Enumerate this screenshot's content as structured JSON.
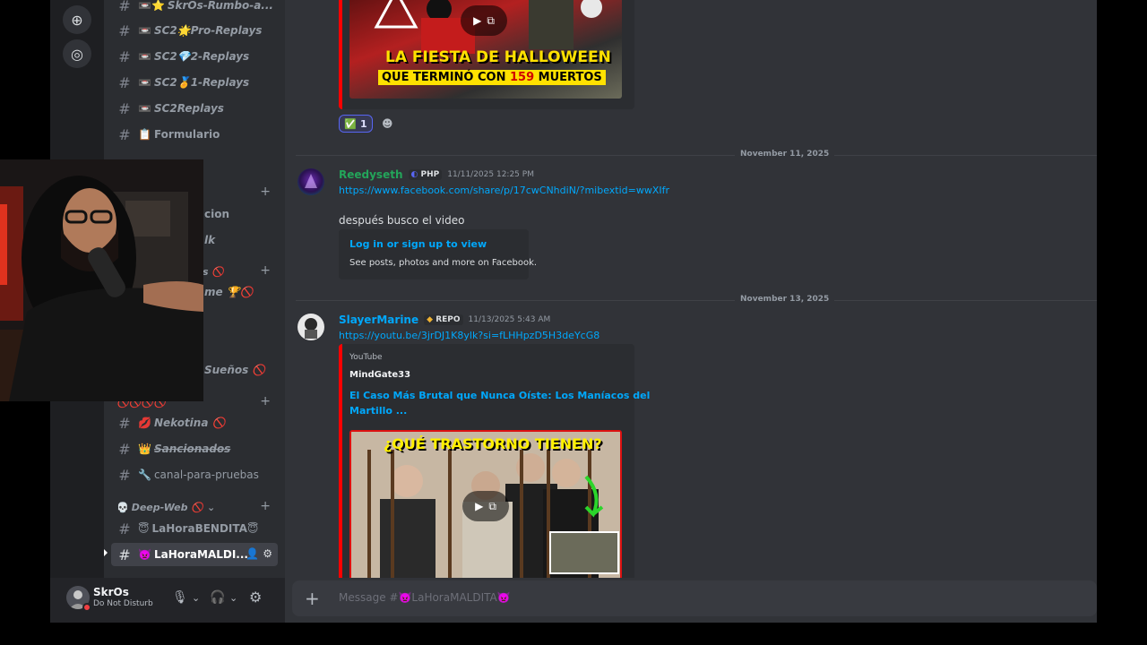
{
  "rail": {
    "add_icon": "plus-icon",
    "discover_icon": "compass-icon"
  },
  "sidebar": {
    "channels_top": [
      {
        "emoji": "📼⭐",
        "label": "SkrOs-Rumbo-a..."
      },
      {
        "emoji": "📼",
        "label": "SC2🌟Pro-Replays"
      },
      {
        "emoji": "📼",
        "label": "SC2💎2-Replays"
      },
      {
        "emoji": "📼",
        "label": "SC2🏅1-Replays"
      },
      {
        "emoji": "📼",
        "label": "SC2Replays"
      },
      {
        "emoji": "📋",
        "label": "Formulario"
      }
    ],
    "partial_channels": [
      {
        "label": "cion"
      },
      {
        "label": "lk"
      },
      {
        "label": "me 🏆🚫"
      },
      {
        "label": "Sueños 🚫"
      }
    ],
    "partial_categories": [
      {
        "label": "s 🚫"
      }
    ],
    "cat_3": "🚫🚫🚫🚫",
    "channels_mid": [
      {
        "emoji": "💋",
        "label": "Nekotina 🚫"
      },
      {
        "emoji": "👑",
        "label": "Sancionados"
      },
      {
        "emoji": "🔧",
        "label": "canal-para-pruebas"
      }
    ],
    "cat_deepweb": "Deep-Web 🚫",
    "channels_bottom": [
      {
        "emoji": "😇",
        "label": "LaHoraBENDITA😇"
      },
      {
        "emoji": "👿",
        "label": "LaHoraMALDI..."
      }
    ]
  },
  "user": {
    "name": "SkrOs",
    "status": "Do Not Disturb"
  },
  "chat": {
    "reaction": {
      "emoji": "✅",
      "count": "1"
    },
    "thumb1": {
      "line1": "LA FIESTA DE HALLOWEEN",
      "line2a": "QUE TERMINÓ CON ",
      "line2b": "159",
      "line2c": " MUERTOS"
    },
    "date1": "November 11, 2025",
    "msg1": {
      "author": "Reedyseth",
      "author_color": "#23a55a",
      "tag": "PHP",
      "time": "11/11/2025 12:25 PM",
      "link": "https://www.facebook.com/share/p/17cwCNhdiN/?mibextid=wwXIfr",
      "text": "después busco el video",
      "embed_title": "Log in or sign up to view",
      "embed_desc": "See posts, photos and more on Facebook."
    },
    "date2": "November 13, 2025",
    "msg2": {
      "author": "SlayerMarine",
      "author_color": "#00a8fc",
      "tag": "REPO",
      "time": "11/13/2025 5:43 AM",
      "link": "https://youtu.be/3jrDJ1K8ylk?si=fLHHpzD5H3deYcG8",
      "provider": "YouTube",
      "channel": "MindGate33",
      "title_line1": "El Caso Más Brutal que Nunca Oíste: Los Maníacos del",
      "title_line2": "Martillo ...",
      "thumb_text": "¿QUÉ TRASTORNO TIENEN?"
    }
  },
  "composer": {
    "placeholder": "Message #👿LaHoraMALDITA👿"
  }
}
